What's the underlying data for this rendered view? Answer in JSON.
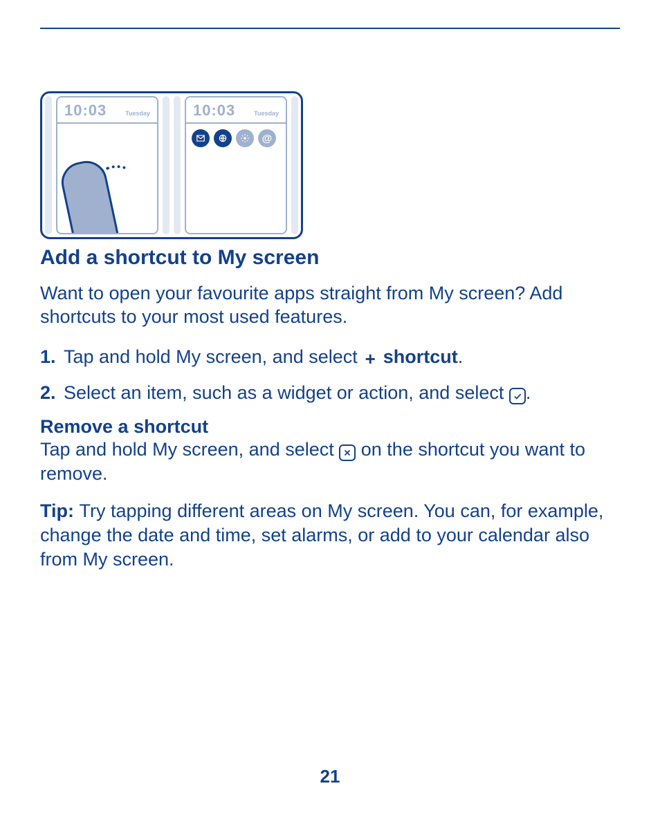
{
  "illustration": {
    "time": "10:03",
    "day": "Tuesday"
  },
  "heading": "Add a shortcut to My screen",
  "intro": "Want to open your favourite apps straight from My screen? Add shortcuts to your most used features.",
  "steps": {
    "one_num": "1.",
    "one_a": "Tap and hold My screen, and select ",
    "one_b": " shortcut",
    "one_c": ".",
    "two_num": "2.",
    "two_a": "Select an item, such as a widget or action, and select ",
    "two_b": "."
  },
  "remove": {
    "heading": "Remove a shortcut",
    "body_a": "Tap and hold My screen, and select ",
    "body_b": " on the shortcut you want to remove."
  },
  "tip": {
    "label": "Tip: ",
    "body": "Try tapping different areas on My screen. You can, for example, change the date and time, set alarms, or add to your calendar also from My screen."
  },
  "page_number": "21"
}
